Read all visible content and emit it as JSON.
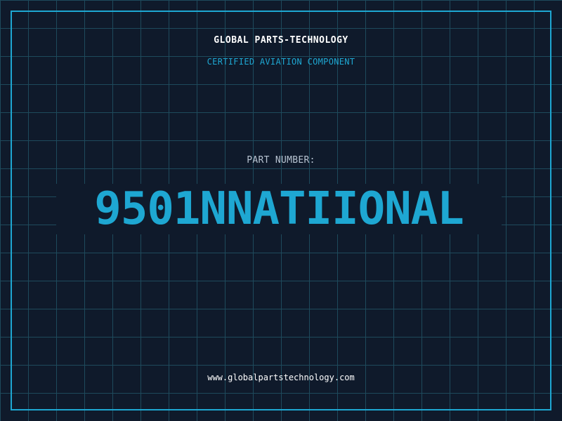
{
  "header": {
    "company": "GLOBAL PARTS-TECHNOLOGY",
    "subtitle": "CERTIFIED AVIATION COMPONENT"
  },
  "part": {
    "label": "PART NUMBER:",
    "number": "9501NNATIIONAL"
  },
  "footer": {
    "website": "www.globalpartstechnology.com"
  },
  "colors": {
    "background": "#0f1a2b",
    "grid": "#1e4a5c",
    "accent": "#1ea7d2",
    "text": "#ffffff",
    "label": "#b8c4d2"
  }
}
